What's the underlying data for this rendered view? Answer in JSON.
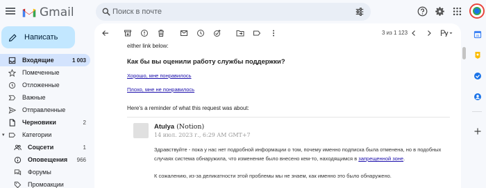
{
  "app": {
    "title": "Gmail"
  },
  "search": {
    "placeholder": "Поиск в почте"
  },
  "compose": {
    "label": "Написать"
  },
  "sidebar": {
    "items": [
      {
        "label": "Входящие",
        "count": "1 003",
        "icon": "inbox-icon"
      },
      {
        "label": "Помеченные",
        "count": "",
        "icon": "star-icon"
      },
      {
        "label": "Отложенные",
        "count": "",
        "icon": "clock-icon"
      },
      {
        "label": "Важные",
        "count": "",
        "icon": "important-icon"
      },
      {
        "label": "Отправленные",
        "count": "",
        "icon": "send-icon"
      },
      {
        "label": "Черновики",
        "count": "2",
        "icon": "draft-icon"
      },
      {
        "label": "Категории",
        "count": "",
        "icon": "label-icon"
      },
      {
        "label": "Соцсети",
        "count": "1",
        "icon": "people-icon"
      },
      {
        "label": "Оповещения",
        "count": "966",
        "icon": "info-icon"
      },
      {
        "label": "Форумы",
        "count": "",
        "icon": "forum-icon"
      },
      {
        "label": "Промоакции",
        "count": "",
        "icon": "tag-icon"
      }
    ]
  },
  "toolbar": {
    "pager": "3 из 1 123"
  },
  "email": {
    "intro_tail": "either link below:",
    "question": "Как бы вы оценили работу службы поддержки?",
    "link_good": "Хорошо, мне понравилось",
    "link_bad": "Плохо, мне не понравилось",
    "reminder": "Here's a reminder of what this request was about:",
    "sender_name": "Atulya",
    "sender_org": "(Notion)",
    "date": "14 июл. 2023 г., 6:29 AM GMT+7",
    "para1_start": "Здравствуйте - пока у нас нет подробной информации о том, почему именно подписка была отменена, но в подобных случаях система обнаружила, что изменение было внесено кем-то, находящимся в ",
    "para1_link": "запрещенной зоне",
    "para1_end": ".",
    "para2": "К сожалению, из-за деликатности этой проблемы мы не знаем, как именно это было обнаружено."
  }
}
